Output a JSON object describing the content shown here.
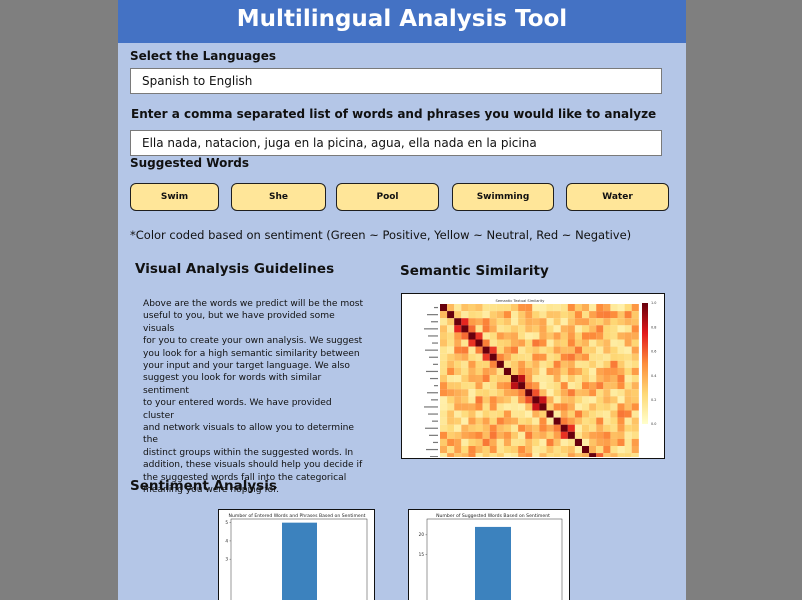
{
  "app": {
    "title": "Multilingual Analysis Tool"
  },
  "languages": {
    "label": "Select the Languages",
    "value": "Spanish to English"
  },
  "words_input": {
    "label": "Enter a comma separated list of words and phrases you would like to analyze",
    "value": "Ella nada, natacion, juga en la picina, agua, ella nada en la picina"
  },
  "suggested": {
    "label": "Suggested Words",
    "chips": [
      "Swim",
      "She",
      "Pool",
      "Swimming",
      "Water"
    ],
    "chip_color": "#ffe699"
  },
  "note": "*Color coded based on sentiment (Green ~ Positive, Yellow ~ Neutral, Red ~ Negative)",
  "guidelines": {
    "heading": "Visual Analysis Guidelines",
    "lines": [
      "Above are the words we predict will be the most",
      "useful to you, but we have provided some visuals",
      "for you to create your own analysis. We suggest",
      "you look for a high semantic similarity between",
      "your input and your target language. We also",
      "suggest you look for words with similar sentiment",
      "to your entered words. We have provided cluster",
      "and network visuals to allow you to determine the",
      "distinct groups within the suggested words. In",
      "addition, these visuals should help you decide if",
      "the suggested words fall into the categorical",
      "meaning you were hoping for."
    ]
  },
  "semantic": {
    "heading": "Semantic Similarity",
    "chart_title": "Semantic Textual Similarity"
  },
  "sentiment": {
    "heading": "Sentiment Analysis",
    "entered_title": "Number of Entered Words and Phrases Based on Sentiment",
    "suggested_title": "Number of Suggested Words Based on Sentiment",
    "bar_color": "#3c82be"
  },
  "chart_data": [
    {
      "type": "heatmap",
      "title": "Semantic Textual Similarity",
      "size": 28,
      "colorbar_ticks": [
        "1.0",
        "0.8",
        "0.6",
        "0.4",
        "0.2",
        "0.0"
      ],
      "color_low": "#ffffcc",
      "color_high": "#67000d"
    },
    {
      "type": "bar",
      "title": "Number of Entered Words and Phrases Based on Sentiment",
      "values": [
        5
      ],
      "yticks": [
        "5",
        "4",
        "3"
      ],
      "ylim": [
        0,
        5.2
      ]
    },
    {
      "type": "bar",
      "title": "Number of Suggested Words Based on Sentiment",
      "values": [
        22
      ],
      "yticks": [
        "20",
        "15"
      ],
      "ylim": [
        0,
        24
      ]
    }
  ]
}
